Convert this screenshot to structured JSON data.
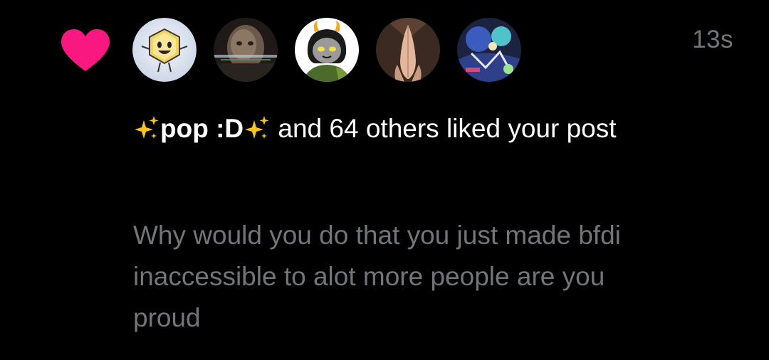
{
  "notification": {
    "type_icon": "heart-icon",
    "timestamp": "13s",
    "actor": {
      "name_prefix_emoji": "sparkles-emoji",
      "name": "pop :D",
      "name_suffix_emoji": "sparkles-emoji"
    },
    "action_text": " and 64 others liked your post",
    "post_text": "Why would you do that you just made bfdi inaccessible to alot more people are you proud",
    "avatars": [
      {
        "name": "avatar-cartoon-character"
      },
      {
        "name": "avatar-glitched-photo"
      },
      {
        "name": "avatar-anime-character"
      },
      {
        "name": "avatar-praying-hands"
      },
      {
        "name": "avatar-colorful-art"
      }
    ]
  },
  "colors": {
    "background": "#000000",
    "heart": "#f91880",
    "primary_text": "#ffffff",
    "secondary_text": "#71767b"
  }
}
